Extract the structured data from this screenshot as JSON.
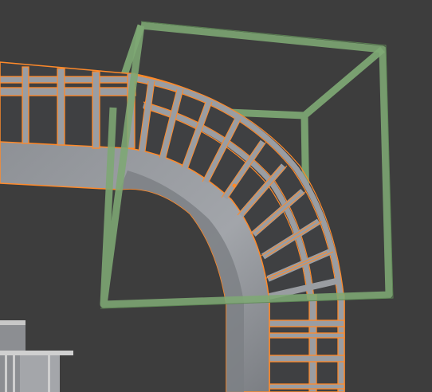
{
  "viewport": {
    "background": "#3d3d3d",
    "selection_outline_color": "#ff8a2a",
    "mesh_fill_color": "#9a9da2",
    "empty_cube_color": "#7ea874"
  },
  "objects": [
    {
      "name": "bridge-arch-mesh",
      "selected": true
    },
    {
      "name": "empty-cube",
      "selected": false
    },
    {
      "name": "railing-mesh",
      "selected": false
    }
  ],
  "icons": [
    "object-origin-icon"
  ]
}
